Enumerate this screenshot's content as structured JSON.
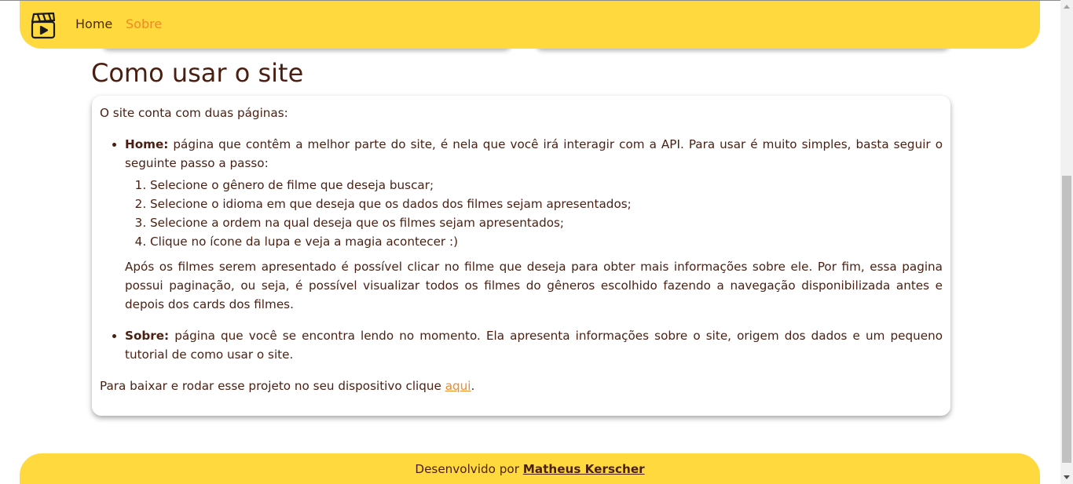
{
  "navbar": {
    "logo_icon": "clapperboard-play-icon",
    "home_label": "Home",
    "about_label": "Sobre"
  },
  "main": {
    "title": "Como usar o site",
    "intro": "O site conta com duas páginas:",
    "home_item": {
      "label": "Home:",
      "text": " página que contêm a melhor parte do site, é nela que você irá interagir com a API. Para usar é muito simples, basta seguir o seguinte passo a passo:",
      "steps": [
        "Selecione o gênero de filme que deseja buscar;",
        "Selecione o idioma em que deseja que os dados dos filmes sejam apresentados;",
        "Selecione a ordem na qual deseja que os filmes sejam apresentados;",
        "Clique no ícone da lupa e veja a magia acontecer :)"
      ],
      "after_steps": "Após os filmes serem apresentado é possível clicar no filme que deseja para obter mais informações sobre ele. Por fim, essa pagina possui paginação, ou seja, é possível visualizar todos os filmes do gêneros escolhido fazendo a navegação disponibilizada antes e depois dos cards dos filmes."
    },
    "about_item": {
      "label": "Sobre:",
      "text": " página que você se encontra lendo no momento. Ela apresenta informações sobre o site, origem dos dados e um pequeno tutorial de como usar o site."
    },
    "download": {
      "prefix": "Para baixar e rodar esse projeto no seu dispositivo clique ",
      "link": "aqui",
      "suffix": "."
    }
  },
  "footer": {
    "prefix": "Desenvolvido por ",
    "author": "Matheus Kerscher"
  },
  "colors": {
    "accent": "#ffd93d",
    "link": "#f08a24",
    "text": "#4a1f12"
  }
}
